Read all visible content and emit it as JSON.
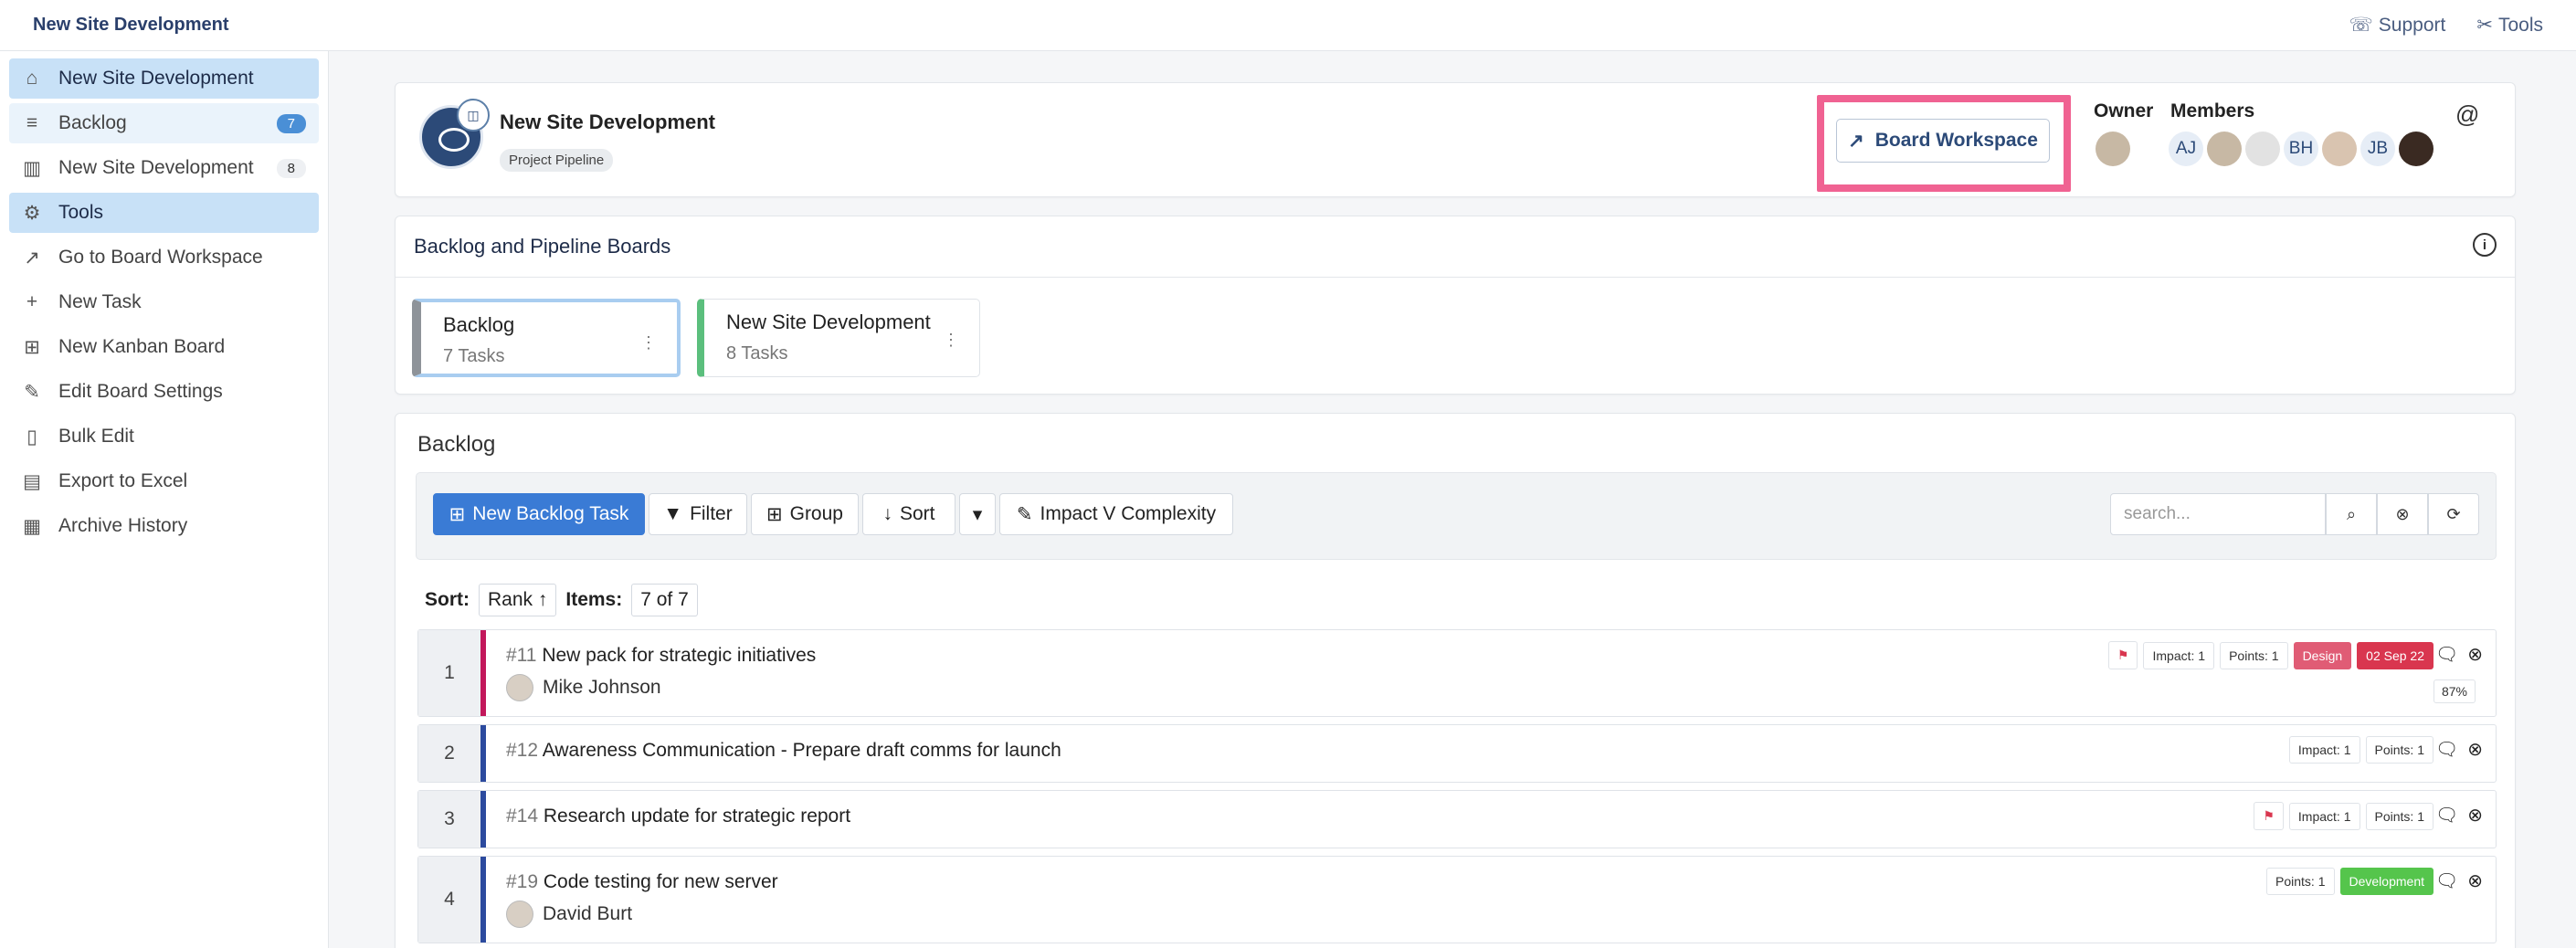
{
  "topbar": {
    "title": "New Site Development",
    "support": "Support",
    "tools": "Tools"
  },
  "sidebar": {
    "items": [
      {
        "label": "New Site Development",
        "icon": "home-icon"
      },
      {
        "label": "Backlog",
        "icon": "list-icon",
        "count": "7"
      },
      {
        "label": "New Site Development",
        "icon": "kanban-icon",
        "count": "8"
      },
      {
        "label": "Tools",
        "icon": "gear-icon"
      },
      {
        "label": "Go to Board Workspace",
        "icon": "external-link-icon"
      },
      {
        "label": "New Task",
        "icon": "plus-icon"
      },
      {
        "label": "New Kanban Board",
        "icon": "folder-plus-icon"
      },
      {
        "label": "Edit Board Settings",
        "icon": "edit-icon"
      },
      {
        "label": "Bulk Edit",
        "icon": "file-edit-icon"
      },
      {
        "label": "Export to Excel",
        "icon": "excel-icon"
      },
      {
        "label": "Archive History",
        "icon": "chart-icon"
      }
    ]
  },
  "header": {
    "project_name": "New Site Development",
    "project_tag": "Project Pipeline",
    "board_workspace": "Board Workspace",
    "owner_label": "Owner",
    "members_label": "Members",
    "members": [
      "AJ",
      "",
      "",
      "BH",
      "",
      "JB",
      ""
    ]
  },
  "boards": {
    "title": "Backlog and Pipeline Boards",
    "tiles": [
      {
        "name": "Backlog",
        "count": "7 Tasks"
      },
      {
        "name": "New Site Development",
        "count": "8 Tasks"
      }
    ]
  },
  "backlog": {
    "title": "Backlog",
    "toolbar": {
      "new_task": "New Backlog Task",
      "filter": "Filter",
      "group": "Group",
      "sort": "Sort",
      "impact": "Impact V Complexity",
      "search_placeholder": "search..."
    },
    "sortbar": {
      "sort_label": "Sort:",
      "sort_value": "Rank",
      "items_label": "Items:",
      "items_value": "7 of 7"
    },
    "rows": [
      {
        "rank": "1",
        "num": "#11",
        "title": "New pack for strategic initiatives",
        "assignee": "Mike Johnson",
        "impact": "Impact: 1",
        "points": "Points: 1",
        "tag": "Design",
        "date": "02 Sep 22",
        "pct": "87%",
        "stripe": "#c2185b"
      },
      {
        "rank": "2",
        "num": "#12",
        "title": "Awareness Communication - Prepare draft comms for launch",
        "impact": "Impact: 1",
        "points": "Points: 1",
        "stripe": "#2c4a9e"
      },
      {
        "rank": "3",
        "num": "#14",
        "title": "Research update for strategic report",
        "impact": "Impact: 1",
        "points": "Points: 1",
        "stripe": "#2c4a9e"
      },
      {
        "rank": "4",
        "num": "#19",
        "title": "Code testing for new server",
        "assignee": "David Burt",
        "points": "Points: 1",
        "tag": "Development",
        "stripe": "#2c4a9e"
      }
    ]
  },
  "colors": {
    "accent": "#3a7bd5",
    "highlight": "#f06292",
    "sidebar_active": "#c8e1f7"
  }
}
